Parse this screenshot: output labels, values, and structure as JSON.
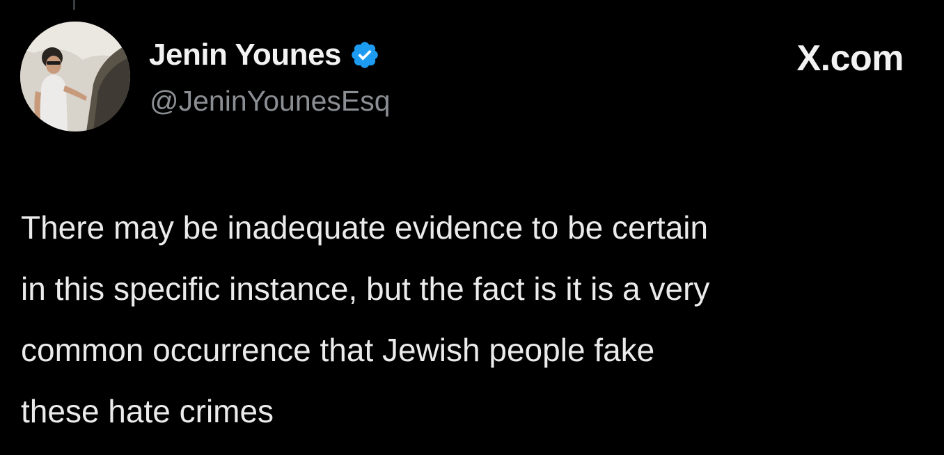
{
  "tweet": {
    "author": {
      "display_name": "Jenin Younes",
      "handle": "@JeninYounesEsq",
      "verified": true,
      "verified_icon": "verified-badge-icon",
      "verified_color": "#1d9bf0"
    },
    "site_label": "X.com",
    "text_lines": [
      "There may be inadequate evidence to be certain",
      "in this specific instance, but the fact is it is a very",
      "common occurrence that Jewish people fake",
      "these hate crimes"
    ]
  },
  "colors": {
    "background": "#000000",
    "text_primary": "#ebebeb",
    "text_secondary": "#8b8f94"
  }
}
